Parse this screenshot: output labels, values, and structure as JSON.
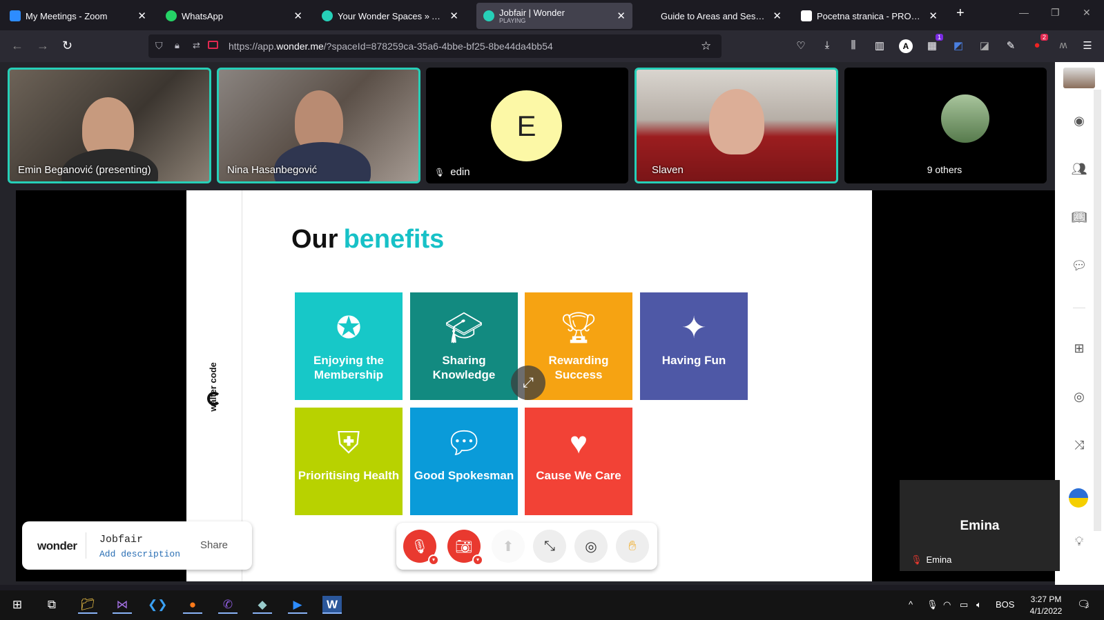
{
  "browser": {
    "tabs": [
      {
        "title": "My Meetings - Zoom",
        "icon": "zoom-icon",
        "color": "#2d8cff"
      },
      {
        "title": "WhatsApp",
        "icon": "whatsapp-icon",
        "color": "#25d366"
      },
      {
        "title": "Your Wonder Spaces » All in O",
        "icon": "wonder-icon",
        "color": "#26d0b8"
      },
      {
        "title": "Jobfair | Wonder",
        "subtitle": "PLAYING",
        "icon": "wonder-icon",
        "color": "#26d0b8"
      },
      {
        "title": "Guide to Areas and Sessions | V",
        "icon": "page-icon",
        "color": "#1c1b22"
      },
      {
        "title": "Pocetna stranica - PRONI Cent",
        "icon": "page-icon",
        "color": "#ffffff"
      }
    ],
    "url_prefix": "https://app.",
    "url_domain": "wonder.me",
    "url_rest": "/?spaceId=878259ca-35a6-4bbe-bf25-8be44da4bb54",
    "extension_badges": {
      "ext1": "1",
      "ext2": "2"
    }
  },
  "participants": [
    {
      "name": "Emin Beganović (presenting)"
    },
    {
      "name": "Nina Hasanbegović"
    },
    {
      "name": "edin",
      "initial": "E"
    },
    {
      "name": "Slaven"
    },
    {
      "name": "9 others"
    }
  ],
  "slide": {
    "brand": "walter code",
    "title_prefix": "Our",
    "title_accent": "benefits",
    "cards": [
      {
        "label": "Enjoying the Membership",
        "color": "#17c8c8",
        "icon": "award-icon"
      },
      {
        "label": "Sharing Knowledge",
        "color": "#128a80",
        "icon": "graduation-cap-icon"
      },
      {
        "label": "Rewarding Success",
        "color": "#f6a312",
        "icon": "trophy-icon"
      },
      {
        "label": "Having Fun",
        "color": "#4e58a6",
        "icon": "party-popper-icon"
      },
      {
        "label": "Prioritising Health",
        "color": "#b8d200",
        "icon": "health-shield-icon"
      },
      {
        "label": "Good Spokesman",
        "color": "#0a9bd9",
        "icon": "chat-bubble-icon"
      },
      {
        "label": "Cause We Care",
        "color": "#f24236",
        "icon": "heart-icon"
      }
    ]
  },
  "room_card": {
    "logo": "wonder",
    "room_name": "Jobfair",
    "description_link": "Add description",
    "share_label": "Share"
  },
  "self_view": {
    "name": "Emina",
    "label": "Emina"
  },
  "taskbar": {
    "language": "BOS",
    "time": "3:27 PM",
    "date": "4/1/2022",
    "notifications": "3"
  }
}
